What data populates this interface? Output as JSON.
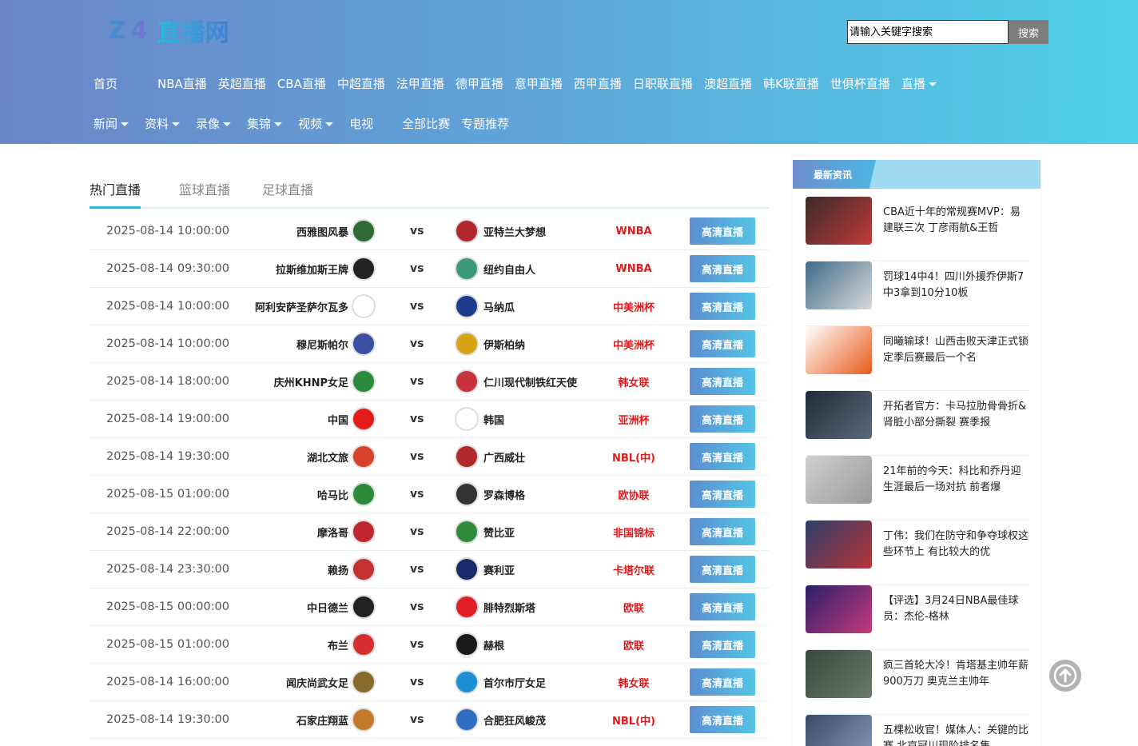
{
  "header": {
    "logo_prefix": "Z4",
    "logo_text": "直播网",
    "search_placeholder": "请输入关键字搜索",
    "search_button": "搜索"
  },
  "nav": {
    "row1": [
      {
        "label": "首页",
        "caret": false
      },
      {
        "label": "NBA直播",
        "caret": false
      },
      {
        "label": "英超直播",
        "caret": false
      },
      {
        "label": "CBA直播",
        "caret": false
      },
      {
        "label": "中超直播",
        "caret": false
      },
      {
        "label": "法甲直播",
        "caret": false
      },
      {
        "label": "德甲直播",
        "caret": false
      },
      {
        "label": "意甲直播",
        "caret": false
      },
      {
        "label": "西甲直播",
        "caret": false
      },
      {
        "label": "日职联直播",
        "caret": false
      },
      {
        "label": "澳超直播",
        "caret": false
      },
      {
        "label": "韩K联直播",
        "caret": false
      },
      {
        "label": "世俱杯直播",
        "caret": false
      },
      {
        "label": "直播",
        "caret": true
      }
    ],
    "row2": [
      {
        "label": "新闻",
        "caret": true
      },
      {
        "label": "资料",
        "caret": true
      },
      {
        "label": "录像",
        "caret": true
      },
      {
        "label": "集锦",
        "caret": true
      },
      {
        "label": "视频",
        "caret": true
      },
      {
        "label": "电视",
        "caret": false
      },
      {
        "label": "全部比赛",
        "caret": false
      },
      {
        "label": "专题推荐",
        "caret": false
      }
    ]
  },
  "tabs": [
    {
      "label": "热门直播",
      "active": true
    },
    {
      "label": "篮球直播",
      "active": false
    },
    {
      "label": "足球直播",
      "active": false
    }
  ],
  "vs_label": "vs",
  "live_button_label": "高清直播",
  "matches": [
    {
      "time": "2025-08-14 10:00:00",
      "home": "西雅图风暴",
      "away": "亚特兰大梦想",
      "league": "WNBA",
      "hc": "#2e6b35",
      "ac": "#b3262e"
    },
    {
      "time": "2025-08-14 09:30:00",
      "home": "拉斯维加斯王牌",
      "away": "纽约自由人",
      "league": "WNBA",
      "hc": "#222222",
      "ac": "#3c9a7a"
    },
    {
      "time": "2025-08-14 10:00:00",
      "home": "阿利安萨圣萨尔瓦多",
      "away": "马纳瓜",
      "league": "中美洲杯",
      "hc": "#ffffff",
      "ac": "#1d3c8c"
    },
    {
      "time": "2025-08-14 10:00:00",
      "home": "穆尼斯帕尔",
      "away": "伊斯柏纳",
      "league": "中美洲杯",
      "hc": "#3b4fa3",
      "ac": "#d6a514"
    },
    {
      "time": "2025-08-14 18:00:00",
      "home": "庆州KHNP女足",
      "away": "仁川现代制铁红天使",
      "league": "韩女联",
      "hc": "#2b8a3e",
      "ac": "#c8323c"
    },
    {
      "time": "2025-08-14 19:00:00",
      "home": "中国",
      "away": "韩国",
      "league": "亚洲杯",
      "hc": "#e21b1b",
      "ac": "#ffffff"
    },
    {
      "time": "2025-08-14 19:30:00",
      "home": "湖北文旅",
      "away": "广西威壮",
      "league": "NBL(中)",
      "hc": "#d8422b",
      "ac": "#b02a2a"
    },
    {
      "time": "2025-08-15 01:00:00",
      "home": "哈马比",
      "away": "罗森博格",
      "league": "欧协联",
      "hc": "#2d8a3a",
      "ac": "#333333"
    },
    {
      "time": "2025-08-14 22:00:00",
      "home": "摩洛哥",
      "away": "赞比亚",
      "league": "非国锦标",
      "hc": "#c0272d",
      "ac": "#2f8a3c"
    },
    {
      "time": "2025-08-14 23:30:00",
      "home": "赖扬",
      "away": "赛利亚",
      "league": "卡塔尔联",
      "hc": "#c43131",
      "ac": "#1b2a6b"
    },
    {
      "time": "2025-08-15 00:00:00",
      "home": "中日德兰",
      "away": "腓特烈斯塔",
      "league": "欧联",
      "hc": "#222222",
      "ac": "#e01f26"
    },
    {
      "time": "2025-08-15 01:00:00",
      "home": "布兰",
      "away": "赫根",
      "league": "欧联",
      "hc": "#d62f2f",
      "ac": "#1a1a1a"
    },
    {
      "time": "2025-08-14 16:00:00",
      "home": "闻庆尚武女足",
      "away": "首尔市厅女足",
      "league": "韩女联",
      "hc": "#8a6a2a",
      "ac": "#1e8fd6"
    },
    {
      "time": "2025-08-14 19:30:00",
      "home": "石家庄翔蓝",
      "away": "合肥狂风峻茂",
      "league": "NBL(中)",
      "hc": "#c57a2a",
      "ac": "#2f6fc0"
    }
  ],
  "sidebar": {
    "title": "最新资讯",
    "news": [
      {
        "title": "CBA近十年的常规赛MVP：易建联三次 丁彦雨航&王哲",
        "c1": "#3a2a2a",
        "c2": "#c23a3a"
      },
      {
        "title": "罚球14中4！四川外援乔伊斯7中3拿到10分10板",
        "c1": "#3e6b8a",
        "c2": "#d9d9d9"
      },
      {
        "title": "同曦输球！山西击败天津正式锁定季后赛最后一个名",
        "c1": "#ffffff",
        "c2": "#e85a1a"
      },
      {
        "title": "开拓者官方：卡马拉肋骨骨折&肾脏小部分撕裂 赛季报",
        "c1": "#1f2a3a",
        "c2": "#5a6a7a"
      },
      {
        "title": "21年前的今天：科比和乔丹迎生涯最后一场对抗 前者爆",
        "c1": "#cfcfcf",
        "c2": "#9a9a9a"
      },
      {
        "title": "丁伟：我们在防守和争夺球权这些环节上 有比较大的优",
        "c1": "#2a3f6a",
        "c2": "#b8343a"
      },
      {
        "title": "【评选】3月24日NBA最佳球员：杰伦-格林",
        "c1": "#2a1f6a",
        "c2": "#c43a7a"
      },
      {
        "title": "疯三首轮大冷！肯塔基主帅年薪900万刀 奥克兰主帅年",
        "c1": "#3a4a3a",
        "c2": "#6a7a6a"
      },
      {
        "title": "五棵松收官！媒体人：关键的比赛 北京冠川现阶排名集",
        "c1": "#3a4a6a",
        "c2": "#8a9aba"
      }
    ]
  }
}
